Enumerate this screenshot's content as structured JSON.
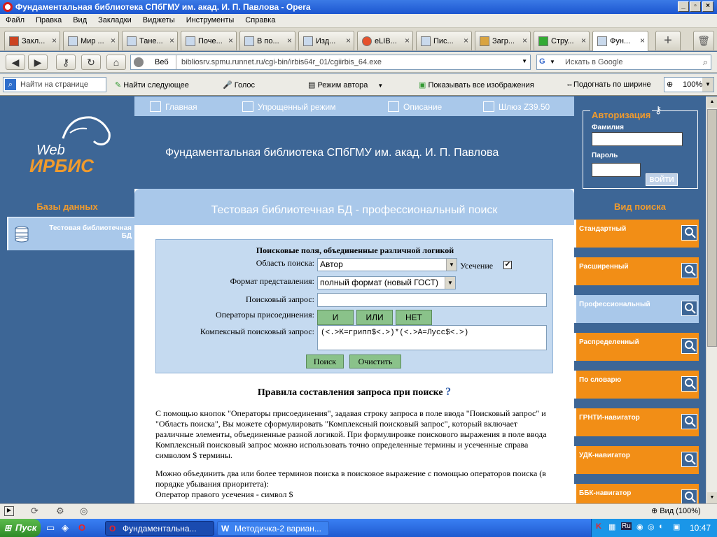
{
  "window": {
    "title": "Фундаментальная библиотека СПбГМУ им. акад. И. П. Павлова - Opera"
  },
  "menu": [
    "Файл",
    "Правка",
    "Вид",
    "Закладки",
    "Виджеты",
    "Инструменты",
    "Справка"
  ],
  "tabs": [
    {
      "label": "Закл..."
    },
    {
      "label": "Мир ..."
    },
    {
      "label": "Тане..."
    },
    {
      "label": "Поче..."
    },
    {
      "label": "В по..."
    },
    {
      "label": "Изд..."
    },
    {
      "label": "eLIB..."
    },
    {
      "label": "Пис..."
    },
    {
      "label": "Загр..."
    },
    {
      "label": "Стру..."
    },
    {
      "label": "Фун..."
    }
  ],
  "address": {
    "scope": "Веб",
    "url": "bibliosrv.spmu.runnet.ru/cgi-bin/irbis64r_01/cgiirbis_64.exe",
    "search_placeholder": "Искать в Google",
    "search_engine": "G"
  },
  "toolbar2": {
    "find_placeholder": "Найти на странице",
    "find_next": "Найти следующее",
    "voice": "Голос",
    "author_mode": "Режим автора",
    "show_images": "Показывать все изображения",
    "fit_width": "Подогнать по ширине",
    "zoom": "100%"
  },
  "site": {
    "logo_web": "Web",
    "logo_irbis": "ИРБИС",
    "nav": [
      "Главная",
      "Упрощенный режим",
      "Описание",
      "Шлюз Z39.50"
    ],
    "title": "Фундаментальная библиотека СПбГМУ им. акад. И. П. Павлова",
    "auth": {
      "heading": "Авторизация",
      "surname_label": "Фамилия",
      "password_label": "Пароль",
      "login_button": "ВОЙТИ"
    },
    "databases": {
      "heading": "Базы данных",
      "item": "Тестовая библиотечная БД"
    },
    "center_heading": "Тестовая библиотечная БД - профессиональный поиск",
    "form": {
      "caption": "Поисковые поля, объединенные различной логикой",
      "area_label": "Область поиска:",
      "area_value": "Автор",
      "truncation_label": "Усечение",
      "format_label": "Формат представления:",
      "format_value": "полный формат (новый ГОСТ)",
      "query_label": "Поисковый запрос:",
      "query_value": "",
      "operators_label": "Операторы присоединения:",
      "op_and": "И",
      "op_or": "ИЛИ",
      "op_not": "НЕТ",
      "complex_label": "Компексный поисковый запрос:",
      "complex_value": "(<.>K=грипп$<.>)*(<.>A=Лусс$<.>)",
      "search_button": "Поиск",
      "clear_button": "Очистить"
    },
    "rules_heading": "Правила составления запроса при поиске",
    "rules_help": "?",
    "para1": "С помощью кнопок \"Операторы присоединения\", задавая строку запроса в поле ввода \"Поисковый запрос\" и \"Область поиска\", Вы можете сформулировать \"Комплексный поисковый запрос\", который включает различные элементы, объединенные разной логикой. При формулировке поискового выражения в поле ввода Комплексный поисковый запрос можно использовать точно определенные термины и усеченные справа символом $ термины.",
    "para2": "Можно объединить два или более терминов поиска в поисковое выражение с помощью операторов поиска (в порядке убывания приоритета):",
    "para3": "Оператор правого усечения - символ $",
    "search_types": {
      "heading": "Вид поиска",
      "items": [
        "Стандартный",
        "Расширенный",
        "Профессиональный",
        "Распределенный",
        "По словарю",
        "ГРНТИ-навигатор",
        "УДК-навигатор",
        "ББК-навигатор"
      ]
    }
  },
  "statusbar": {
    "zoom": "Вид (100%)"
  },
  "taskbar": {
    "start": "Пуск",
    "task1": "Фундаментальна...",
    "task2": "Методичка-2 вариан...",
    "clock": "10:47"
  }
}
